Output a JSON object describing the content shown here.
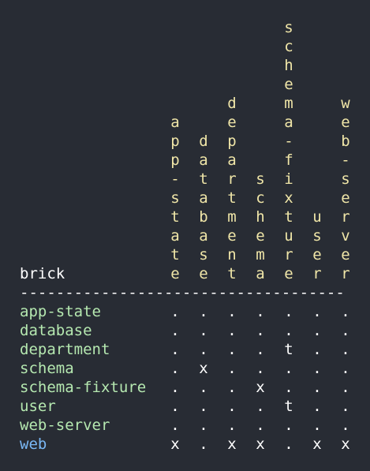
{
  "header_label": "brick",
  "separator": "------------------------------------",
  "columns": [
    "app-state",
    "database",
    "department",
    "schema",
    "schema-fixture",
    "user",
    "web-server"
  ],
  "rows": [
    {
      "name": "app-state",
      "cells": [
        ".",
        ".",
        ".",
        ".",
        ".",
        ".",
        "."
      ]
    },
    {
      "name": "database",
      "cells": [
        ".",
        ".",
        ".",
        ".",
        ".",
        ".",
        "."
      ]
    },
    {
      "name": "department",
      "cells": [
        ".",
        ".",
        ".",
        ".",
        "t",
        ".",
        "."
      ]
    },
    {
      "name": "schema",
      "cells": [
        ".",
        "x",
        ".",
        ".",
        ".",
        ".",
        "."
      ]
    },
    {
      "name": "schema-fixture",
      "cells": [
        ".",
        ".",
        ".",
        "x",
        ".",
        ".",
        "."
      ]
    },
    {
      "name": "user",
      "cells": [
        ".",
        ".",
        ".",
        ".",
        "t",
        ".",
        "."
      ]
    },
    {
      "name": "web-server",
      "cells": [
        ".",
        ".",
        ".",
        ".",
        ".",
        ".",
        "."
      ]
    },
    {
      "name": "web",
      "cells": [
        "x",
        ".",
        "x",
        "x",
        ".",
        "x",
        "x"
      ]
    }
  ],
  "colors": {
    "background": "#282c34",
    "column_letters": "#f0e6a8",
    "row_names": "#b5e8b0",
    "highlight_row": "#7ab8f5",
    "text": "#ffffff"
  },
  "highlight_row_name": "web"
}
